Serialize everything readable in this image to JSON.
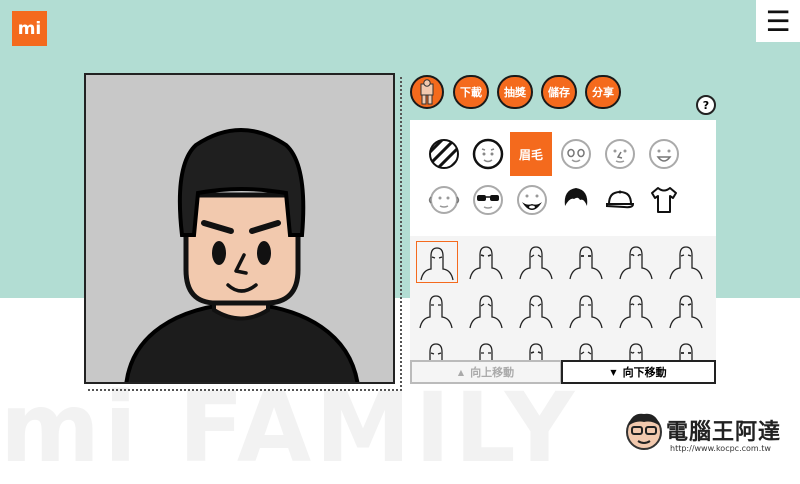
{
  "logo": {
    "text": "mi"
  },
  "toolbar": {
    "download_label": "下載",
    "lottery_label": "抽獎",
    "save_label": "儲存",
    "share_label": "分享"
  },
  "help": {
    "label": "?"
  },
  "categories": {
    "active_label": "眉毛"
  },
  "scroll": {
    "up_label": "向上移動",
    "down_label": "向下移動"
  },
  "watermark": {
    "text": "mi FAMILY"
  },
  "brand": {
    "name": "電腦王阿達",
    "url": "http://www.kocpc.com.tw"
  },
  "colors": {
    "accent": "#f46a1d",
    "teal": "#b2ddd3",
    "canvas": "#c8c8c8"
  }
}
